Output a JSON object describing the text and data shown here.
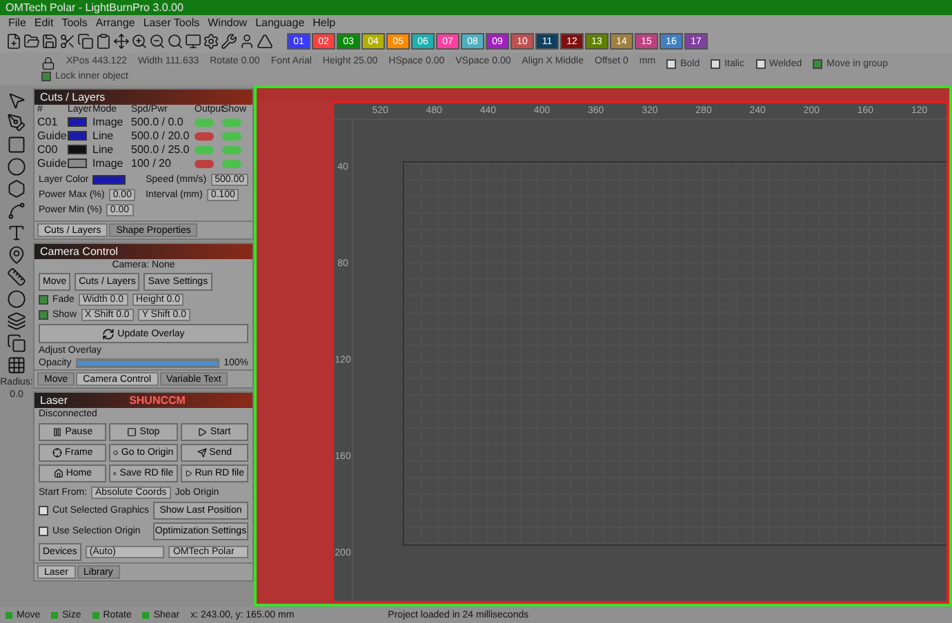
{
  "window": {
    "title": "OMTech Polar - LightBurnPro 3.0.00"
  },
  "menu": [
    "File",
    "Edit",
    "Tools",
    "Arrange",
    "Laser Tools",
    "Window",
    "Language",
    "Help"
  ],
  "palette": [
    {
      "label": "01",
      "color": "#3a3aff"
    },
    {
      "label": "02",
      "color": "#ff4040"
    },
    {
      "label": "03",
      "color": "#0a8a0a"
    },
    {
      "label": "04",
      "color": "#b0b000"
    },
    {
      "label": "05",
      "color": "#ff8a00"
    },
    {
      "label": "06",
      "color": "#20b0b0"
    },
    {
      "label": "07",
      "color": "#ff40a0"
    },
    {
      "label": "08",
      "color": "#50b0c0"
    },
    {
      "label": "09",
      "color": "#a020c0"
    },
    {
      "label": "10",
      "color": "#c05050"
    },
    {
      "label": "11",
      "color": "#104060"
    },
    {
      "label": "12",
      "color": "#801010"
    },
    {
      "label": "13",
      "color": "#608000"
    },
    {
      "label": "14",
      "color": "#a08040"
    },
    {
      "label": "15",
      "color": "#c04080"
    },
    {
      "label": "16",
      "color": "#4080c0"
    },
    {
      "label": "17",
      "color": "#8040a0"
    }
  ],
  "properties": [
    {
      "label": "XPos",
      "value": "443.122"
    },
    {
      "label": "Width",
      "value": "111.633"
    },
    {
      "label": "Rotate",
      "value": "0.00"
    },
    {
      "label": "Font",
      "value": "Arial"
    },
    {
      "label": "Height",
      "value": "25.00"
    },
    {
      "label": "HSpace",
      "value": "0.00"
    },
    {
      "label": "VSpace",
      "value": "0.00"
    },
    {
      "label": "Align X",
      "value": "Middle"
    },
    {
      "label": "Offset",
      "value": "0"
    }
  ],
  "property_options": [
    {
      "label": "Bold",
      "checked": false
    },
    {
      "label": "Italic",
      "checked": false
    },
    {
      "label": "Welded",
      "checked": false
    },
    {
      "label": "Move in group",
      "checked": true
    },
    {
      "label": "Lock inner object",
      "checked": true
    }
  ],
  "unit": "mm",
  "radius": {
    "label": "Radius:",
    "value": "0.0"
  },
  "cuts_layers": {
    "title": "Cuts / Layers",
    "columns": [
      "#",
      "Layer",
      "Mode",
      "Spd/Pwr",
      "Output",
      "Show"
    ],
    "rows": [
      {
        "name": "C01",
        "color": "#1a1ab0",
        "mode": "Image",
        "spd_pwr": "500.0 / 0.0",
        "output": true,
        "show": true
      },
      {
        "name": "Guide",
        "color": "#1a1ab0",
        "mode": "Line",
        "spd_pwr": "500.0 / 20.0",
        "output": false,
        "show": true
      },
      {
        "name": "C00",
        "color": "#101010",
        "mode": "Line",
        "spd_pwr": "500.0 / 25.0",
        "output": true,
        "show": true
      },
      {
        "name": "Guide",
        "color": "#8a8a8a",
        "mode": "Image",
        "spd_pwr": "100 / 20",
        "output": false,
        "show": true
      }
    ],
    "settings": [
      {
        "label": "Layer Color",
        "kind": "color",
        "color": "#1a1ab0"
      },
      {
        "label": "Speed (mm/s)",
        "value": "500.00"
      },
      {
        "label": "Power Max (%)",
        "value": "0.00"
      },
      {
        "label": "Interval (mm)",
        "value": "0.100"
      },
      {
        "label": "Power Min (%)",
        "value": "0.00"
      }
    ],
    "tabs": [
      {
        "label": "Cuts / Layers",
        "selected": true
      },
      {
        "label": "Shape Properties",
        "selected": false
      }
    ]
  },
  "camera_control": {
    "title": "Camera Control",
    "camera": "Camera: None",
    "buttons": [
      "Move",
      "Cuts / Layers",
      "Save Settings"
    ],
    "options": [
      {
        "label": "Fade",
        "checked": true,
        "field_a": "Width 0.0",
        "field_b": "Height 0.0"
      },
      {
        "label": "Show",
        "checked": true,
        "field_a": "X Shift 0.0",
        "field_b": "Y Shift 0.0"
      }
    ],
    "update": "Update Overlay",
    "adjust": "Adjust Overlay",
    "opacity": {
      "label": "Opacity",
      "level": 1.0,
      "reading": "100%"
    },
    "tabs": [
      {
        "label": "Move",
        "selected": false
      },
      {
        "label": "Camera Control",
        "selected": true
      },
      {
        "label": "Variable Text",
        "selected": false
      }
    ]
  },
  "laser": {
    "title": "Laser",
    "device_name": "SHUNCCM",
    "status": "Disconnected",
    "buttons": [
      "Pause",
      "Stop",
      "Start",
      "Frame",
      "Go to Origin",
      "Send",
      "Home",
      "Save RD file",
      "Run RD file"
    ],
    "start_from": {
      "label": "Start From:",
      "value": "Absolute Coords"
    },
    "job_origin": "Job Origin",
    "options": [
      {
        "label": "Cut Selected Graphics",
        "checked": false
      },
      {
        "label": "Use Selection Origin",
        "checked": false
      }
    ],
    "side_buttons": [
      "Show Last Position",
      "Optimization Settings"
    ],
    "devices": {
      "label": "Devices",
      "port": "(Auto)",
      "machine": "OMTech Polar"
    },
    "tabs": [
      {
        "label": "Laser",
        "selected": true
      },
      {
        "label": "Library",
        "selected": false
      }
    ]
  },
  "canvas": {
    "top_ruler": [
      "520",
      "480",
      "440",
      "400",
      "360",
      "320",
      "280",
      "240",
      "200",
      "160",
      "120"
    ],
    "left_ruler": [
      "40",
      "80",
      "120",
      "160",
      "200"
    ]
  },
  "status_bar": {
    "modes": [
      "Move",
      "Size",
      "Rotate",
      "Shear"
    ],
    "coords": "x: 243.00, y: 165.00 mm",
    "message": "Project loaded in 24 milliseconds"
  }
}
